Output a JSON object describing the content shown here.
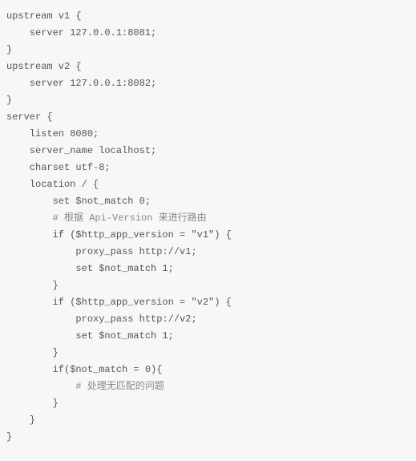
{
  "code": {
    "lines": [
      "upstream v1 {",
      "    server 127.0.0.1:8081;",
      "}",
      "upstream v2 {",
      "    server 127.0.0.1:8082;",
      "}",
      "",
      "server {",
      "    listen 8080;",
      "    server_name localhost;",
      "    charset utf-8;",
      "    location / {",
      "        set $not_match 0;",
      "        # 根据 Api-Version 来进行路由",
      "        if ($http_app_version = \"v1\") {",
      "            proxy_pass http://v1;",
      "            set $not_match 1;",
      "        }",
      "",
      "        if ($http_app_version = \"v2\") {",
      "            proxy_pass http://v2;",
      "            set $not_match 1;",
      "        }",
      "",
      "        if($not_match = 0){",
      "            # 处理无匹配的问题",
      "        }",
      "    }",
      "}"
    ]
  }
}
